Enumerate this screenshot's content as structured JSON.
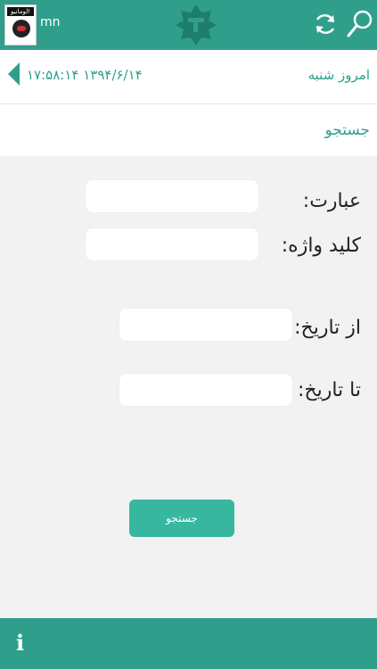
{
  "header": {
    "user_label": "mn",
    "ad_banner_text": "لومانيو!",
    "colors": {
      "primary": "#2f9f8c",
      "button": "#37b7a0"
    },
    "icons": [
      "refresh-icon",
      "search-icon",
      "app-logo-icon"
    ]
  },
  "datebar": {
    "today_label": "امروز شنبه",
    "datetime": "۱۷:۵۸:۱۴   ۱۳۹۴/۶/۱۴"
  },
  "section": {
    "title": "جستجو"
  },
  "form": {
    "phrase_label": "عبارت:",
    "phrase_value": "",
    "keyword_label": "کلید واژه:",
    "keyword_value": "",
    "from_date_label": "از تاریخ:",
    "from_date_value": "",
    "to_date_label": "تا تاریخ:",
    "to_date_value": "",
    "submit_label": "جستجو"
  },
  "footer": {
    "info_glyph": "i"
  }
}
